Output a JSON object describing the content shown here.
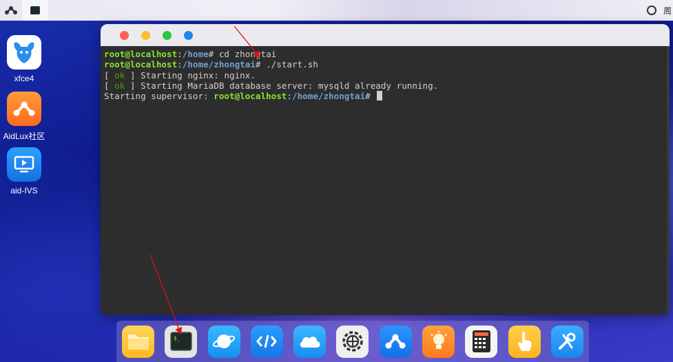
{
  "top_panel": {
    "clock_text": "周"
  },
  "desktop_icons": [
    {
      "label": "xfce4",
      "icon": "mouse-logo-icon",
      "color": "#2a8ff0"
    },
    {
      "label": "AidLux社区",
      "icon": "aidlux-community-icon",
      "color": "#ff7a2e"
    },
    {
      "label": "aid-IVS",
      "icon": "monitor-play-icon",
      "color": "#1a8cf5"
    }
  ],
  "terminal": {
    "lines": [
      {
        "user": "root@localhost",
        "path": "/home",
        "cmd": "# cd zhongtai"
      },
      {
        "user": "root@localhost",
        "path": "/home/zhongtai",
        "cmd": "# ./start.sh"
      },
      {
        "pre": "[ ",
        "ok": "ok",
        "post": " ] Starting nginx: nginx."
      },
      {
        "pre": "[ ",
        "ok": "ok",
        "post": " ] Starting MariaDB database server: mysqld already running."
      },
      {
        "prefix": "Starting supervisor: ",
        "user": "root@localhost",
        "path": "/home/zhongtai",
        "cmd": "# "
      }
    ]
  },
  "dock": {
    "items": [
      {
        "name": "files-icon",
        "color": "#ffc93a"
      },
      {
        "name": "terminal-icon",
        "color": "#e6e6e6"
      },
      {
        "name": "browser-planet-icon",
        "color": "#1fa3ff"
      },
      {
        "name": "code-editor-icon",
        "color": "#1a8cf5"
      },
      {
        "name": "cloud-icon",
        "color": "#2aa6f5"
      },
      {
        "name": "settings-gear-icon",
        "color": "#f0f0f0"
      },
      {
        "name": "aidlux-icon",
        "color": "#1a7ff0"
      },
      {
        "name": "lightbulb-icon",
        "color": "#ff8c2a"
      },
      {
        "name": "calculator-icon",
        "color": "#f5f5f5"
      },
      {
        "name": "touch-hand-icon",
        "color": "#ffc22a"
      },
      {
        "name": "tools-icon",
        "color": "#2a9ff5"
      }
    ]
  },
  "colors": {
    "prompt_user": "#8ae234",
    "prompt_path": "#729fcf",
    "ok": "#4e9a06",
    "dot_close": "#ff5f57",
    "dot_min": "#febc2e",
    "dot_max": "#28c840",
    "dot_extra": "#1e88f0"
  }
}
